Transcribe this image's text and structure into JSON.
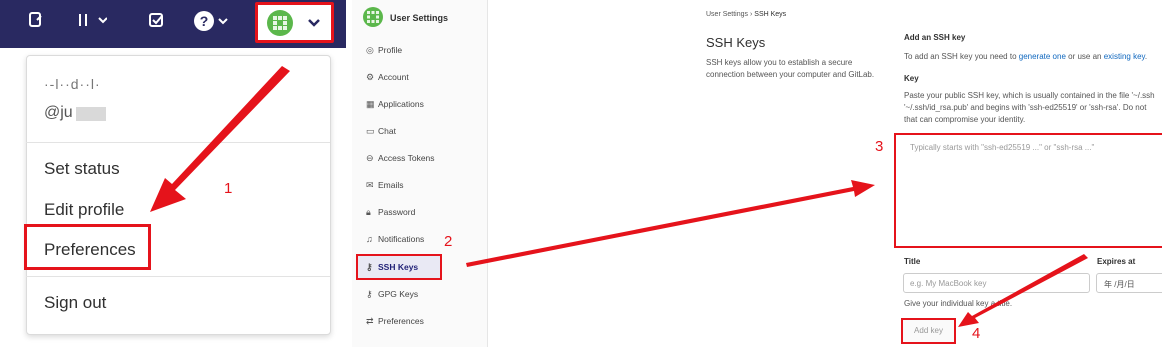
{
  "left_panel": {
    "topbar": {
      "icons": [
        "merge-request-icon",
        "merge-request-list-icon",
        "todo-icon",
        "help-icon",
        "avatar"
      ]
    },
    "user": {
      "name": "·-l··d··l·",
      "handle": "@ju"
    },
    "menu": {
      "items": [
        "Set status",
        "Edit profile",
        "Preferences",
        "Sign out"
      ]
    }
  },
  "right_panel": {
    "sidebar": {
      "title": "User Settings",
      "items": [
        "Profile",
        "Account",
        "Applications",
        "Chat",
        "Access Tokens",
        "Emails",
        "Password",
        "Notifications",
        "SSH Keys",
        "GPG Keys",
        "Preferences"
      ],
      "active": "SSH Keys"
    },
    "breadcrumb": {
      "parent": "User Settings",
      "sep": "›",
      "current": "SSH Keys"
    },
    "page_title": "SSH Keys",
    "intro": "SSH keys allow you to establish a secure connection between your computer and GitLab.",
    "add_heading": "Add an SSH key",
    "add_text_prefix": "To add an SSH key you need to ",
    "add_link1": "generate one",
    "add_text_mid": " or use an ",
    "add_link2": "existing key",
    "add_text_end": ".",
    "key_label": "Key",
    "key_help": "Paste your public SSH key, which is usually contained in the file '~/.ssh '~/.ssh/id_rsa.pub' and begins with 'ssh-ed25519' or 'ssh-rsa'. Do not that can compromise your identity.",
    "key_placeholder": "Typically starts with \"ssh-ed25519 ...\" or \"ssh-rsa ...\"",
    "title_label": "Title",
    "title_placeholder": "e.g. My MacBook key",
    "title_help": "Give your individual key a title.",
    "expires_label": "Expires at",
    "expires_placeholder": "年 /月/日",
    "add_button": "Add key"
  },
  "annotations": {
    "n1": "1",
    "n2": "2",
    "n3": "3",
    "n4": "4"
  },
  "colors": {
    "topbar": "#292961",
    "annotation": "#e5131b",
    "link": "#1068bf"
  }
}
